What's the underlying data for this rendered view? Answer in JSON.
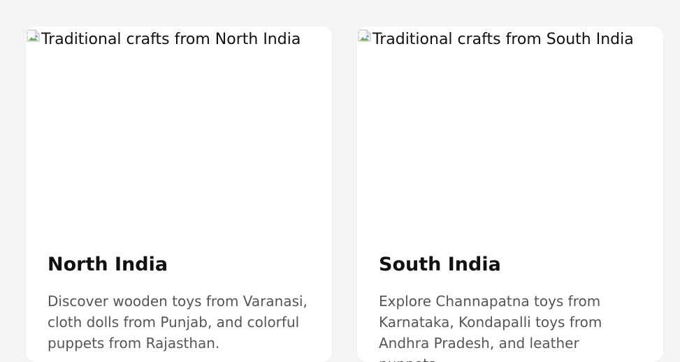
{
  "cards": [
    {
      "image_alt": "Traditional crafts from North India",
      "title": "North India",
      "description": "Discover wooden toys from Varanasi, cloth dolls from Punjab, and colorful puppets from Rajasthan."
    },
    {
      "image_alt": "Traditional crafts from South India",
      "title": "South India",
      "description": "Explore Channapatna toys from Karnataka, Kondapalli toys from Andhra Pradesh, and leather puppets."
    }
  ],
  "colors": {
    "page_background": "#f4f4f4",
    "card_background": "#ffffff",
    "title_text": "#111111",
    "description_text": "#555555"
  },
  "icons": {
    "broken_image": "broken-image-icon"
  }
}
